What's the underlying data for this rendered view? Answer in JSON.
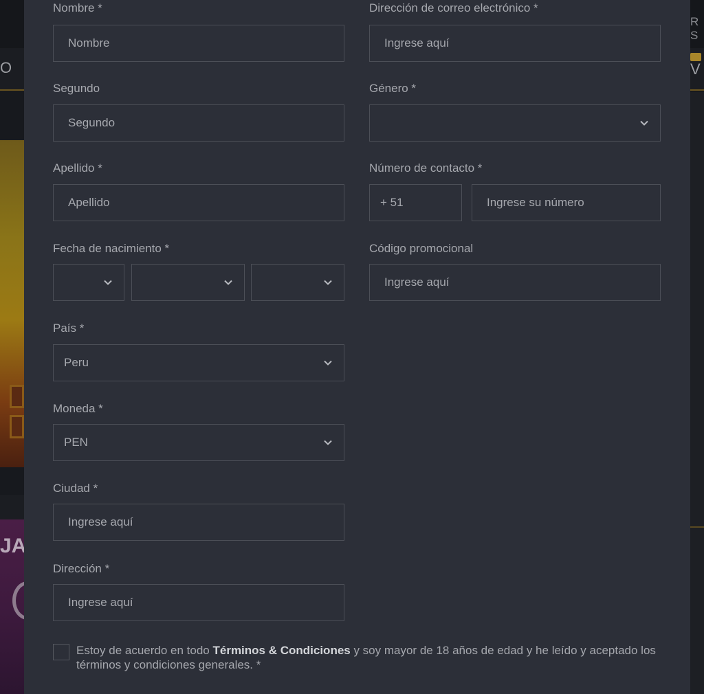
{
  "background": {
    "left_nav_text": "O",
    "right_top_text": "R S",
    "right_nav_text": "V",
    "banner_text": "JA"
  },
  "form": {
    "first_name": {
      "label": "Nombre *",
      "placeholder": "Nombre"
    },
    "email": {
      "label": "Dirección de correo electrónico *",
      "placeholder": "Ingrese aquí"
    },
    "middle_name": {
      "label": "Segundo",
      "placeholder": "Segundo"
    },
    "gender": {
      "label": "Género *",
      "value": ""
    },
    "last_name": {
      "label": "Apellido *",
      "placeholder": "Apellido"
    },
    "phone": {
      "label": "Número de contacto *",
      "prefix": "+ 51",
      "placeholder": "Ingrese su número"
    },
    "birth_date": {
      "label": "Fecha de nacimiento *",
      "day": "",
      "month": "",
      "year": ""
    },
    "promo_code": {
      "label": "Código promocional",
      "placeholder": "Ingrese aquí"
    },
    "country": {
      "label": "País *",
      "value": "Peru"
    },
    "currency": {
      "label": "Moneda *",
      "value": "PEN"
    },
    "city": {
      "label": "Ciudad *",
      "placeholder": "Ingrese aquí"
    },
    "address": {
      "label": "Dirección *",
      "placeholder": "Ingrese aquí"
    },
    "terms": {
      "text_before": "Estoy de acuerdo en todo ",
      "link": "Términos & Condiciones",
      "text_after": " y soy mayor de 18 años de edad y he leído y aceptado los términos y condiciones generales. *",
      "checked": false
    }
  },
  "icons": {
    "dropdown": "chevron-down-icon"
  },
  "colors": {
    "modal_bg": "#2c2f38",
    "field_border": "#4c4f57",
    "text": "#a6a8ae",
    "accent": "#a8862a"
  }
}
